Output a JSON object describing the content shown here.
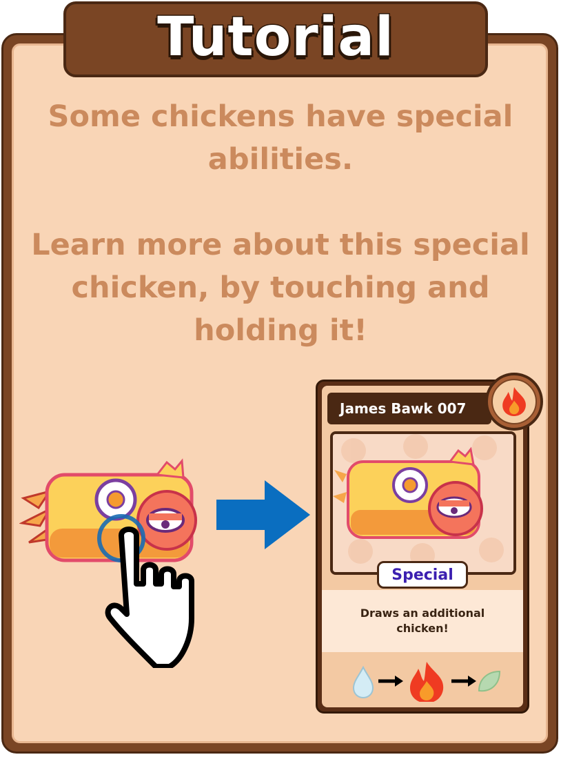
{
  "title": "Tutorial",
  "instructions": {
    "line1": "Some chickens have special abilities.",
    "line2": "Learn more about this special chicken, by touching and holding it!"
  },
  "card": {
    "name": "James Bawk 007",
    "element_icon": "fire-icon",
    "tag": "Special",
    "ability": "Draws an additional chicken!",
    "element_cycle": [
      "water-drop-icon",
      "arrow-right-icon",
      "fire-icon",
      "arrow-right-icon",
      "leaf-icon"
    ]
  },
  "illustration": {
    "gesture_icon": "hand-pointer-icon",
    "arrow_icon": "arrow-right-icon"
  },
  "colors": {
    "frame_brown": "#7a4524",
    "panel_peach": "#f9d5b6",
    "instruction_text": "#cb8a5d",
    "arrow_blue": "#0a6ec0",
    "special_text": "#3b1fb0"
  }
}
